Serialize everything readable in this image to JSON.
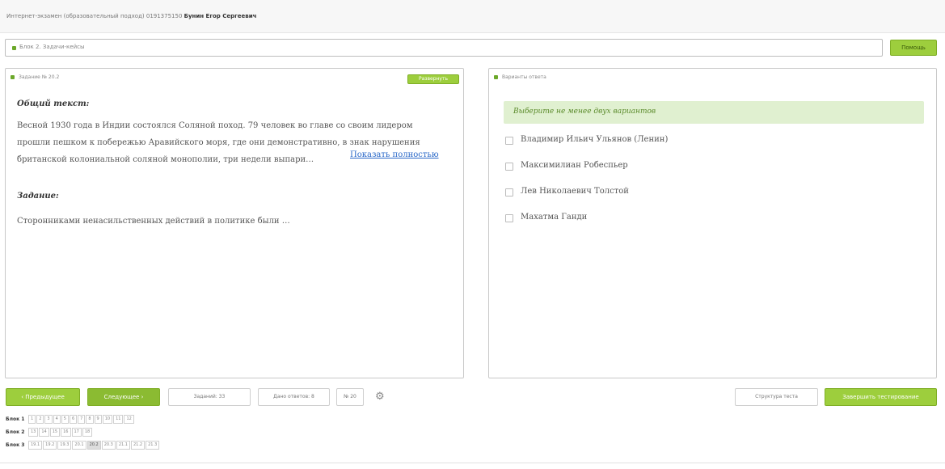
{
  "header": {
    "text": "Интернет-экзамен (образовательный подход) 0191375150",
    "name": "Бунин Егор Сергеевич"
  },
  "block_bar": {
    "label": "Блок 2. Задачи-кейсы"
  },
  "help_button": "Помощь",
  "task_panel": {
    "title": "Задание № 20.2",
    "expand_button": "Развернуть",
    "common_text_label": "Общий текст:",
    "common_text": "Весной 1930 года в Индии состоялся Соляной поход. 79 человек во главе со своим лидером прошли пешком к побережью Аравийского моря, где они демонстративно, в знак нарушения британской колониальной соляной монополии, три недели выпари…",
    "show_full_link": "Показать полностью",
    "task_label": "Задание:",
    "task_text": "Сторонниками ненасильственных действий в политике были …"
  },
  "answers_panel": {
    "title": "Варианты ответа",
    "hint": "Выберите не менее двух вариантов",
    "options": [
      "Владимир Ильич Ульянов (Ленин)",
      "Максимилиан Робеспьер",
      "Лев Николаевич Толстой",
      "Махатма Ганди"
    ]
  },
  "toolbar": {
    "prev": "‹ Предыдущее",
    "next": "Следующее ›",
    "tasks": "Заданий: 33",
    "answers_given": "Дано ответов: 8",
    "current_number": "№ 20",
    "structure": "Структура теста",
    "finish": "Завершить тестирование"
  },
  "blocks": [
    {
      "label": "Блок 1",
      "items": [
        "1",
        "2",
        "3",
        "4",
        "5",
        "6",
        "7",
        "8",
        "9",
        "10",
        "11",
        "12"
      ]
    },
    {
      "label": "Блок 2",
      "items": [
        "13",
        "14",
        "15",
        "16",
        "17",
        "18"
      ]
    },
    {
      "label": "Блок 3",
      "items": [
        "19.1",
        "19.2",
        "19.3",
        "20.1",
        "20.2",
        "20.3",
        "21.1",
        "21.2",
        "21.3"
      ]
    }
  ],
  "current_block_item": "20.2",
  "colors": {
    "accent_green": "#9dce3d",
    "hint_bg": "#e0f0d0",
    "link_blue": "#2a68c8"
  }
}
